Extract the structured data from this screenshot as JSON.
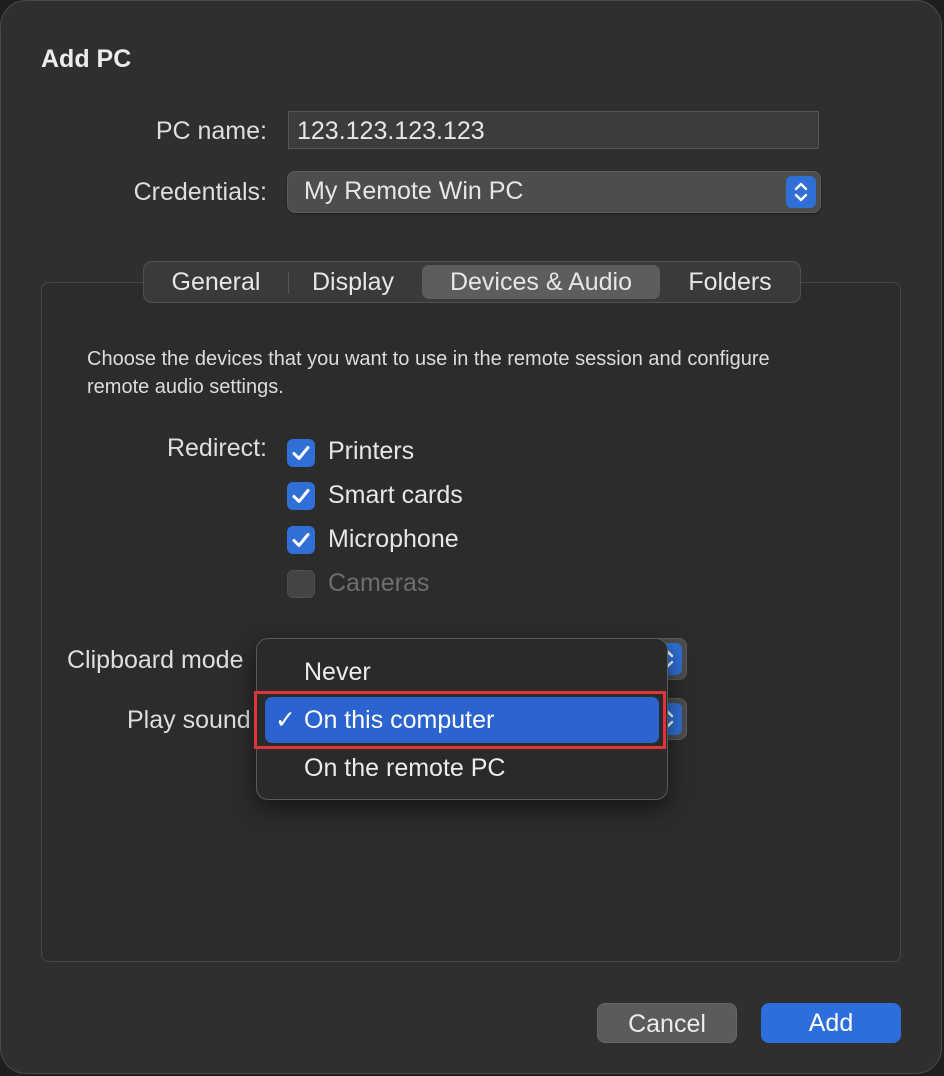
{
  "dialog": {
    "title": "Add PC"
  },
  "pc_name": {
    "label": "PC name:",
    "value": "123.123.123.123"
  },
  "credentials": {
    "label": "Credentials:",
    "value": "My Remote Win PC"
  },
  "tabs": [
    {
      "label": "General",
      "selected": false
    },
    {
      "label": "Display",
      "selected": false
    },
    {
      "label": "Devices & Audio",
      "selected": true
    },
    {
      "label": "Folders",
      "selected": false
    }
  ],
  "devices_audio": {
    "description": "Choose the devices that you want to use in the remote session and configure remote audio settings.",
    "redirect_label": "Redirect:",
    "redirect_items": [
      {
        "label": "Printers",
        "checked": true,
        "enabled": true
      },
      {
        "label": "Smart cards",
        "checked": true,
        "enabled": true
      },
      {
        "label": "Microphone",
        "checked": true,
        "enabled": true
      },
      {
        "label": "Cameras",
        "checked": false,
        "enabled": false
      }
    ],
    "clipboard_label": "Clipboard mode",
    "play_sound_label": "Play sound"
  },
  "sound_menu": {
    "options": [
      {
        "label": "Never",
        "selected": false
      },
      {
        "label": "On this computer",
        "selected": true
      },
      {
        "label": "On the remote PC",
        "selected": false
      }
    ],
    "check_glyph": "✓"
  },
  "buttons": {
    "cancel": "Cancel",
    "add": "Add"
  },
  "colors": {
    "accent": "#2c6fdc",
    "highlight_box": "#e0343a",
    "background": "#2f2f2f"
  },
  "icons": {
    "stepper": "chevron-up-down-icon",
    "checkbox": "checkmark-icon"
  }
}
